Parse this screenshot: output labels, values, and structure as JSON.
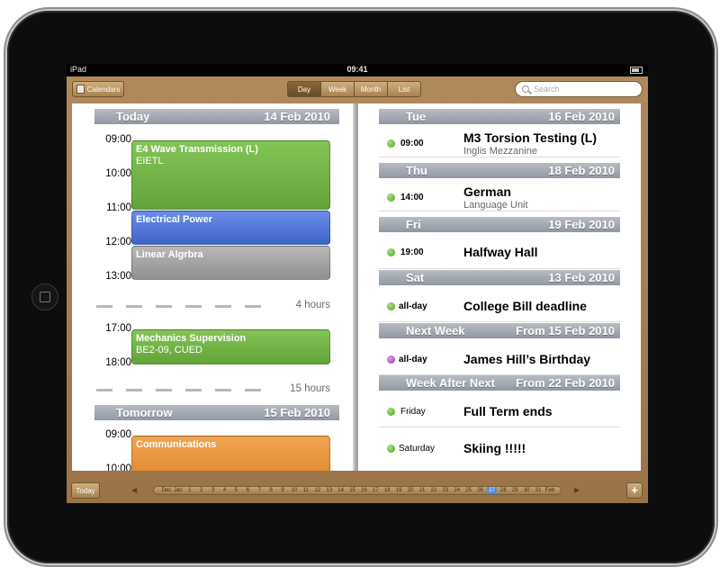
{
  "status": {
    "carrier": "iPad",
    "time": "09:41"
  },
  "toolbar": {
    "calendars_label": "Calendars",
    "views": [
      "Day",
      "Week",
      "Month",
      "List"
    ],
    "active_view": "Day",
    "search_placeholder": "Search"
  },
  "left_page": {
    "today_header": {
      "label": "Today",
      "date": "14 Feb 2010"
    },
    "hours": [
      "09:00",
      "10:00",
      "11:00",
      "12:00",
      "13:00"
    ],
    "events": [
      {
        "title": "E4 Wave Transmission (L)",
        "subtitle": "EIETL",
        "color": "#6BB046"
      },
      {
        "title": "Electrical Power",
        "subtitle": "",
        "color": "#4A70D6"
      },
      {
        "title": "Linear Algrbra",
        "subtitle": "",
        "color": "#A3A3A3"
      }
    ],
    "gap1": "4 hours",
    "hours2": [
      "17:00",
      "18:00"
    ],
    "event4": {
      "title": "Mechanics Supervision",
      "subtitle": "BE2-09, CUED",
      "color": "#6BB046"
    },
    "gap2": "15 hours",
    "tomorrow_header": {
      "label": "Tomorrow",
      "date": "15 Feb 2010"
    },
    "hours3": [
      "09:00",
      "10:00"
    ],
    "event5": {
      "title": "Communications",
      "color": "#E8953A"
    }
  },
  "right_page": {
    "groups": [
      {
        "day": "Tue",
        "date": "16 Feb 2010",
        "time": "09:00",
        "title": "M3 Torsion Testing (L)",
        "subtitle": "Inglis Mezzanine",
        "dot": "green"
      },
      {
        "day": "Thu",
        "date": "18 Feb 2010",
        "time": "14:00",
        "title": "German",
        "subtitle": "Language Unit",
        "dot": "green"
      },
      {
        "day": "Fri",
        "date": "19 Feb 2010",
        "time": "19:00",
        "title": "Halfway Hall",
        "subtitle": "",
        "dot": "green"
      },
      {
        "day": "Sat",
        "date": "13 Feb 2010",
        "time": "all-day",
        "title": "College Bill deadline",
        "subtitle": "",
        "dot": "green"
      },
      {
        "day": "Next Week",
        "date": "From 15 Feb 2010",
        "time": "all-day",
        "title": "James Hill’s Birthday",
        "subtitle": "",
        "dot": "purple"
      },
      {
        "day": "Week After Next",
        "date": "From 22 Feb 2010",
        "time": "Friday",
        "title": "Full Term ends",
        "subtitle": "",
        "dot": "green"
      }
    ],
    "extra": {
      "time": "Saturday",
      "title": "Skiing !!!!!",
      "dot": "green"
    }
  },
  "bottombar": {
    "today_label": "Today",
    "plus_label": "+",
    "date_strip": [
      "Dec",
      "Jan",
      "1",
      "2",
      "3",
      "4",
      "5",
      "6",
      "7",
      "8",
      "9",
      "10",
      "11",
      "12",
      "13",
      "14",
      "15",
      "16",
      "17",
      "18",
      "19",
      "20",
      "21",
      "22",
      "23",
      "24",
      "25",
      "26",
      "27",
      "28",
      "29",
      "30",
      "31",
      "Feb"
    ],
    "selected_date": "27"
  },
  "colors": {
    "leather": "#A7804F",
    "header_gray": "#A3A9B2",
    "selected": "#4A8FE6"
  }
}
